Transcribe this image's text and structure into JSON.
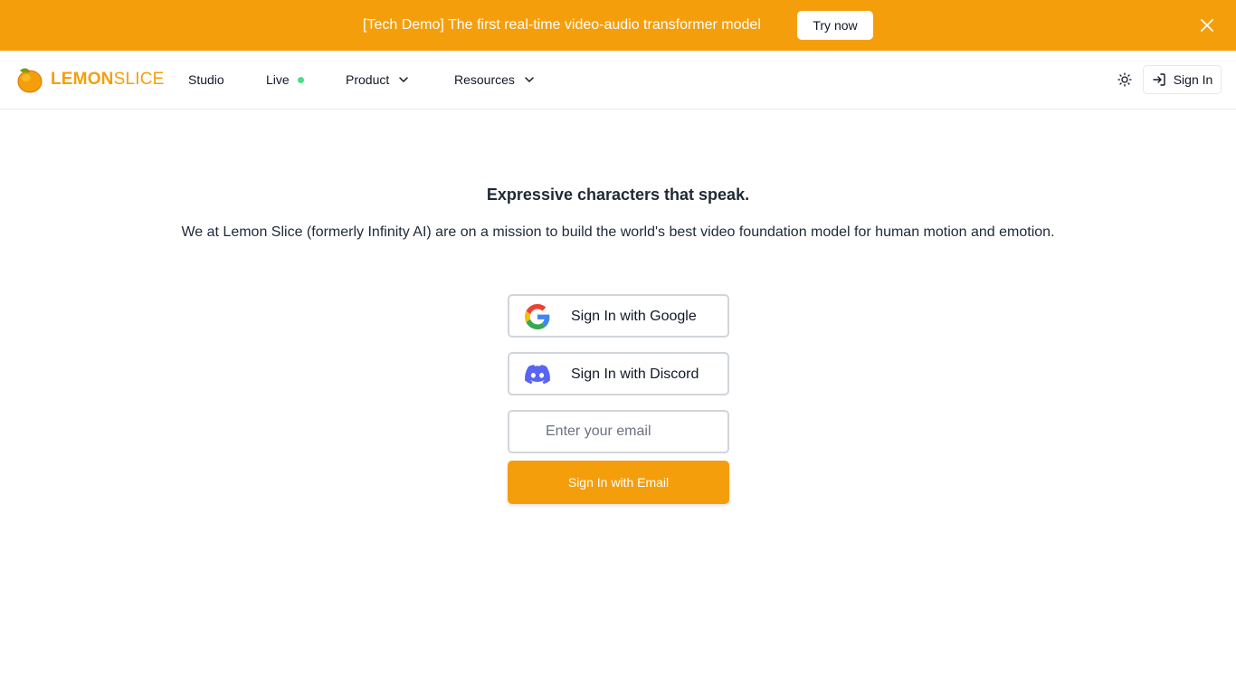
{
  "colors": {
    "brand": "#f59e0b",
    "live_indicator": "#4ade80",
    "discord": "#5865f2"
  },
  "banner": {
    "text": "[Tech Demo] The first real-time video-audio transformer model",
    "cta_label": "Try now",
    "close_icon": "close-icon"
  },
  "navbar": {
    "logo": {
      "icon": "lemon-icon",
      "text_bold": "LEMON",
      "text_light": "SLICE"
    },
    "items": [
      {
        "label": "Studio"
      },
      {
        "label": "Live",
        "indicator": "live-dot"
      },
      {
        "label": "Product",
        "icon": "chevron-down-icon"
      },
      {
        "label": "Resources",
        "icon": "chevron-down-icon"
      }
    ],
    "theme_toggle_icon": "sun-icon",
    "signin": {
      "label": "Sign In",
      "icon": "sign-in-icon"
    }
  },
  "main": {
    "headline": "Expressive characters that speak.",
    "subline": "We at Lemon Slice (formerly Infinity AI) are on a mission to build the world's best video foundation model for human motion and emotion.",
    "google_button": {
      "label": "Sign In with Google",
      "icon": "google-icon"
    },
    "discord_button": {
      "label": "Sign In with Discord",
      "icon": "discord-icon"
    },
    "email_input": {
      "placeholder": "Enter your email",
      "value": ""
    },
    "email_button": {
      "label": "Sign In with Email"
    }
  }
}
